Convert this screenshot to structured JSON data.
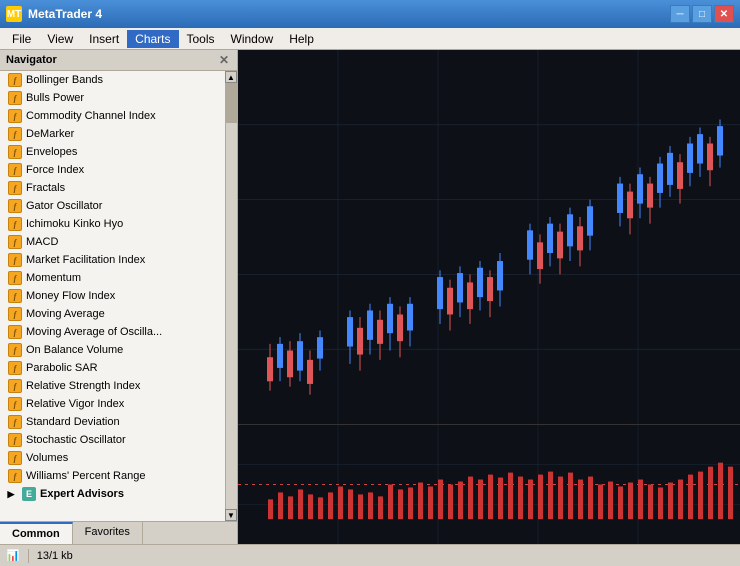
{
  "window": {
    "title": "MetaTrader 4",
    "icon": "MT"
  },
  "titlebar": {
    "minimize_label": "─",
    "restore_label": "□",
    "close_label": "✕",
    "inner_minimize": "_",
    "inner_restore": "□",
    "inner_close": "✕"
  },
  "menu": {
    "items": [
      "File",
      "View",
      "Insert",
      "Charts",
      "Tools",
      "Window",
      "Help"
    ]
  },
  "navigator": {
    "title": "Navigator",
    "close_label": "✕",
    "indicators": [
      "Bollinger Bands",
      "Bulls Power",
      "Commodity Channel Index",
      "DeMarker",
      "Envelopes",
      "Force Index",
      "Fractals",
      "Gator Oscillator",
      "Ichimoku Kinko Hyo",
      "MACD",
      "Market Facilitation Index",
      "Momentum",
      "Money Flow Index",
      "Moving Average",
      "Moving Average of Oscilla...",
      "On Balance Volume",
      "Parabolic SAR",
      "Relative Strength Index",
      "Relative Vigor Index",
      "Standard Deviation",
      "Stochastic Oscillator",
      "Volumes",
      "Williams' Percent Range"
    ],
    "sections": [
      "Expert Advisors"
    ],
    "tabs": [
      "Common",
      "Favorites"
    ],
    "active_tab": "Common"
  },
  "status": {
    "bars_icon": "|||||||",
    "info": "13/1 kb"
  }
}
